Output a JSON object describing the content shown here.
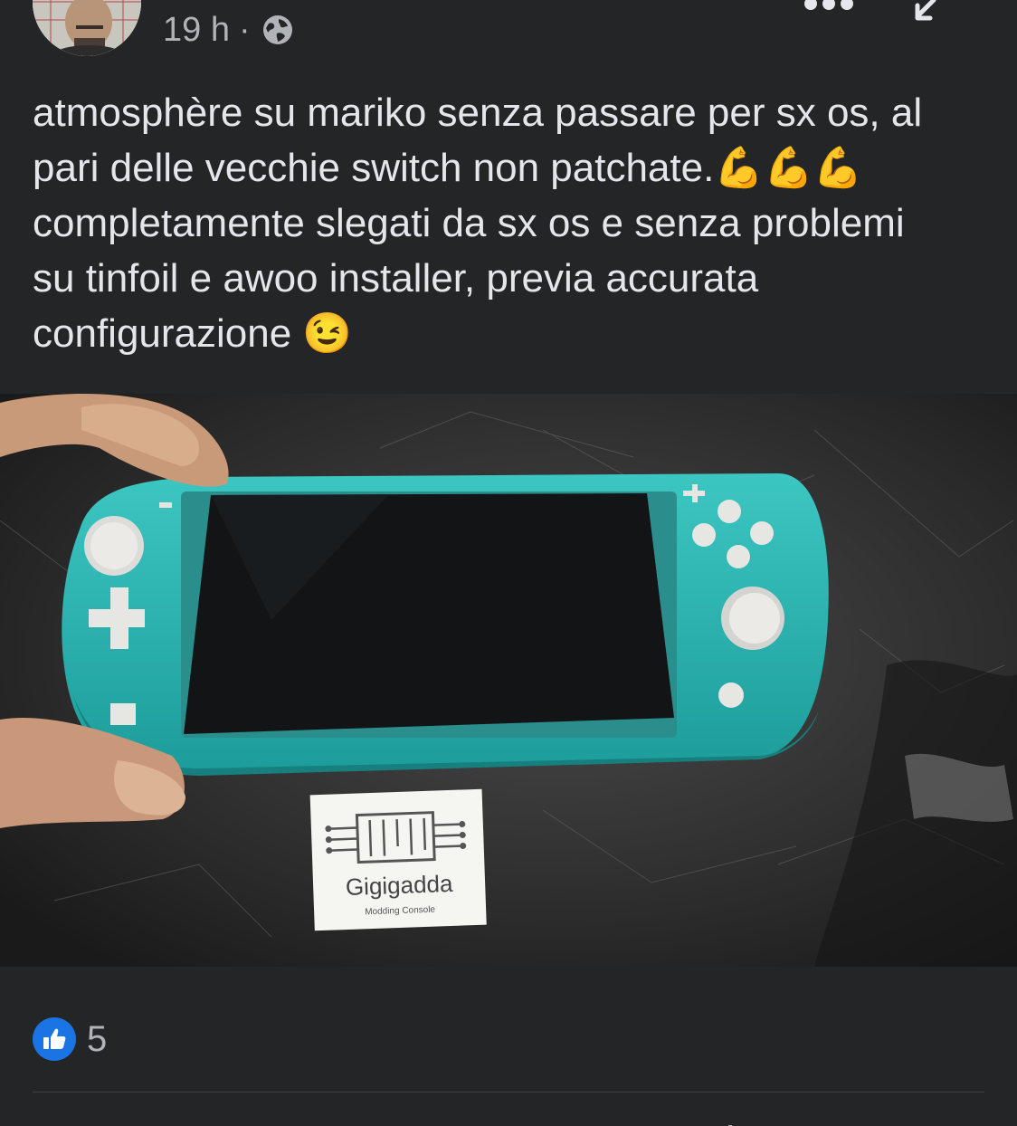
{
  "post": {
    "author_avatar_icon": "profile-photo",
    "time_ago": "19 h",
    "separator": "·",
    "audience_icon": "globe-icon",
    "more_icon": "more-horizontal-icon",
    "collapse_icon": "collapse-arrow-icon",
    "caption": "atmosphère su mariko senza passare per sx os, al\npari delle vecchie switch non patchate.💪💪💪\ncompletamente slegati da sx os e senza problemi\nsu tinfoil e awoo installer, previa accurata\nconfigurazione 😉"
  },
  "photo": {
    "subject": "turquoise handheld console on dark table",
    "label_brand": "Gigigadda",
    "label_tagline": "Modding Console"
  },
  "reactions": {
    "icon": "like-icon",
    "count": "5"
  },
  "colors": {
    "background": "#242526",
    "text_primary": "#e4e6eb",
    "text_secondary": "#b0b3b8",
    "like_blue": "#1b74e4",
    "console_teal": "#2bb3b1"
  }
}
